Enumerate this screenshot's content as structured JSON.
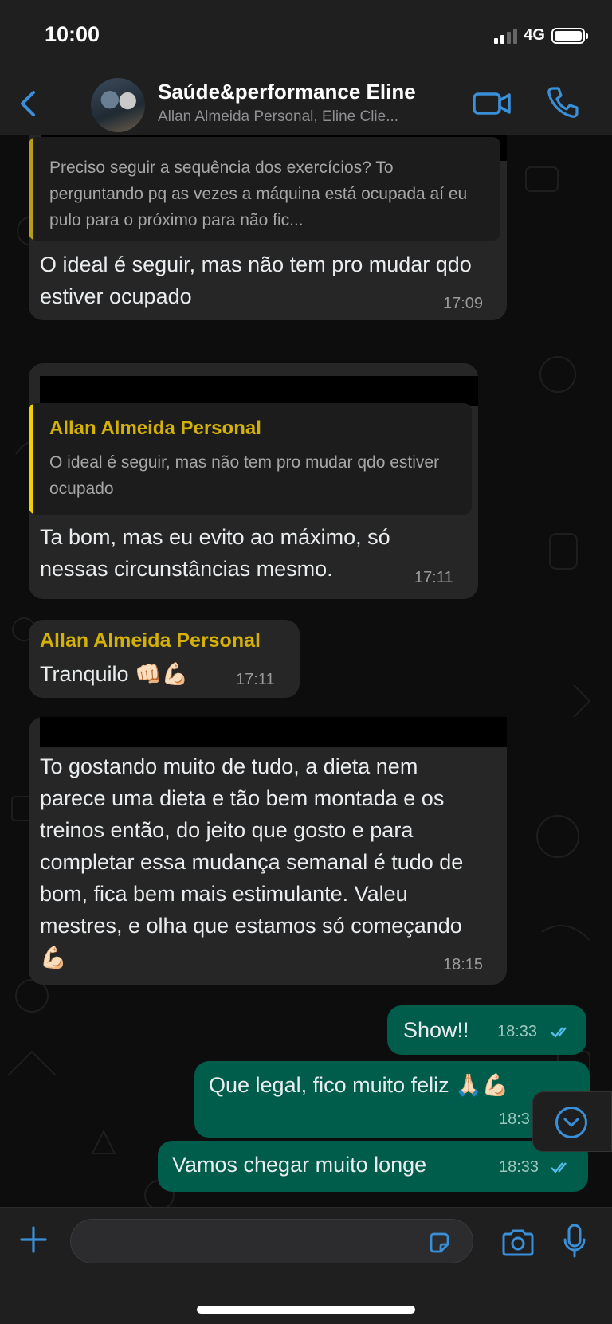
{
  "status_bar": {
    "time": "10:00",
    "network": "4G"
  },
  "header": {
    "group_name": "Saúde&performance Eline",
    "members": "Allan Almeida Personal, Eline Clie..."
  },
  "messages": {
    "m1": {
      "quote_text": "Preciso seguir a sequência dos exercícios? To perguntando pq as vezes a máquina está ocupada aí eu pulo para o próximo para não fic...",
      "text": "O ideal é seguir, mas não tem pro mudar qdo estiver ocupado",
      "time": "17:09"
    },
    "m2": {
      "quote_author": "Allan Almeida Personal",
      "quote_text": "O ideal é seguir, mas não tem pro mudar qdo estiver ocupado",
      "text": "Ta bom, mas eu evito ao máximo, só nessas circunstâncias mesmo.",
      "time": "17:11"
    },
    "m3": {
      "sender": "Allan Almeida Personal",
      "text": "Tranquilo 👊🏻💪🏻",
      "time": "17:11"
    },
    "m4": {
      "text": "To gostando muito de tudo, a dieta nem parece uma dieta e tão bem montada e os treinos então, do jeito que gosto e para completar essa mudança semanal é tudo de bom, fica bem mais estimulante. Valeu mestres, e olha que estamos só começando 💪🏻",
      "time": "18:15"
    },
    "m5": {
      "text": "Show!!",
      "time": "18:33"
    },
    "m6": {
      "text": "Que legal, fico muito feliz 🙏🏻💪🏻",
      "time": "18:3"
    },
    "m7": {
      "text": "Vamos chegar muito longe",
      "time": "18:33"
    }
  },
  "input": {
    "placeholder": ""
  },
  "colors": {
    "accent_blue": "#3a8fd9",
    "outgoing_bubble": "#005c4b",
    "incoming_bubble": "#262626",
    "sender_name": "#d4b106"
  },
  "icons": [
    "back-chevron-icon",
    "video-call-icon",
    "phone-icon",
    "plus-icon",
    "sticker-icon",
    "camera-icon",
    "microphone-icon",
    "chevron-down-icon",
    "double-check-icon"
  ]
}
